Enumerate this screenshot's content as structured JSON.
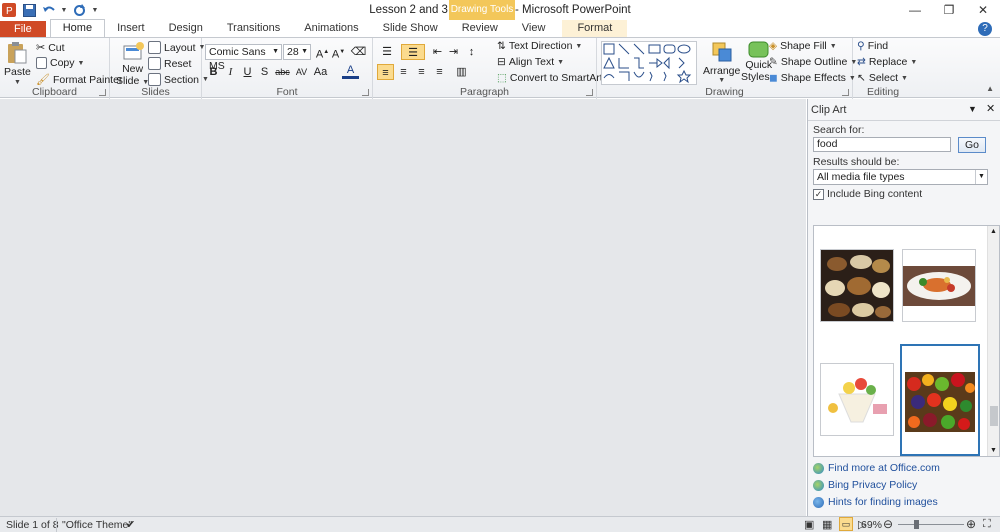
{
  "window": {
    "title": "Lesson 2 and 3 - Food tests  -  Microsoft PowerPoint",
    "context_header": "Drawing Tools"
  },
  "tabs": [
    "File",
    "Home",
    "Insert",
    "Design",
    "Transitions",
    "Animations",
    "Slide Show",
    "Review",
    "View",
    "Format"
  ],
  "clipboard": {
    "paste": "Paste",
    "cut": "Cut",
    "copy": "Copy",
    "format_painter": "Format Painter",
    "label": "Clipboard"
  },
  "slides": {
    "new_slide": "New",
    "new_slide2": "Slide",
    "layout": "Layout",
    "reset": "Reset",
    "section": "Section",
    "label": "Slides"
  },
  "font": {
    "family": "Comic Sans MS",
    "size": "28",
    "label": "Font"
  },
  "paragraph": {
    "text_direction": "Text Direction",
    "align_text": "Align Text",
    "smartart": "Convert to SmartArt",
    "label": "Paragraph"
  },
  "drawing": {
    "arrange": "Arrange",
    "quick_styles": "Quick",
    "quick_styles2": "Styles",
    "shape_fill": "Shape Fill",
    "shape_outline": "Shape Outline",
    "shape_effects": "Shape Effects",
    "label": "Drawing"
  },
  "editing": {
    "find": "Find",
    "replace": "Replace",
    "select": "Select",
    "label": "Editing"
  },
  "clip_art": {
    "title": "Clip Art",
    "search_label": "Search for:",
    "search_value": "food",
    "go": "Go",
    "results_label": "Results should be:",
    "media_type": "All media file types",
    "include_bing": "Include Bing content",
    "links": [
      "Find more at Office.com",
      "Bing Privacy Policy",
      "Hints for finding images"
    ]
  },
  "status": {
    "slide": "Slide 1 of 8",
    "theme": "\"Office Theme\"",
    "zoom": "69%"
  },
  "colors": {
    "file_tab": "#d04a26",
    "context": "#f3c75a",
    "accent": "#2e74b5"
  }
}
